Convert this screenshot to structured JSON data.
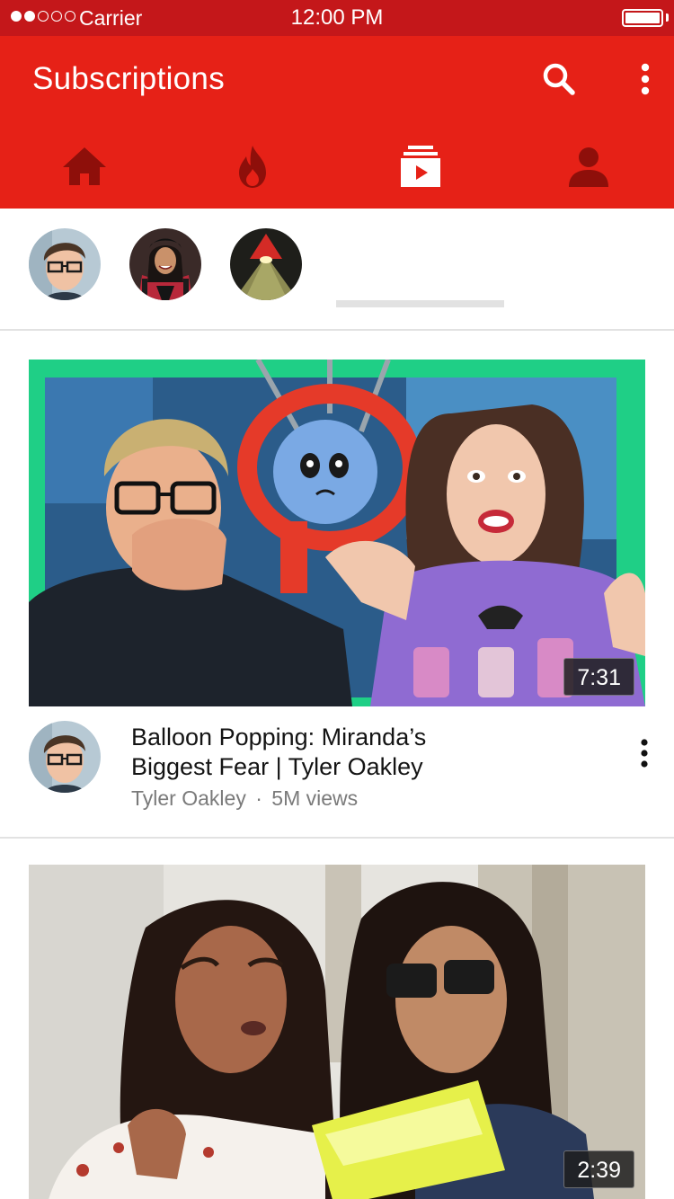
{
  "status_bar": {
    "carrier": "Carrier",
    "time": "12:00 PM",
    "signal_bars_filled": 2,
    "signal_bars_total": 5
  },
  "app_bar": {
    "title": "Subscriptions",
    "background_color": "#e62117",
    "actions": [
      {
        "icon": "search-icon"
      },
      {
        "icon": "more-vert-icon"
      }
    ]
  },
  "tabs": [
    {
      "name": "home",
      "icon": "home-icon",
      "active": false
    },
    {
      "name": "trending",
      "icon": "flame-icon",
      "active": false
    },
    {
      "name": "subscriptions",
      "icon": "subscriptions-icon",
      "active": true
    },
    {
      "name": "account",
      "icon": "person-icon",
      "active": false
    }
  ],
  "subscribed_channels": [
    {
      "avatar": "tyler-oakley-avatar"
    },
    {
      "avatar": "channel-avatar-woman"
    },
    {
      "avatar": "channel-avatar-lamp"
    }
  ],
  "videos": [
    {
      "title_line1": "Balloon Popping: Miranda’s",
      "title_line2": "Biggest Fear | Tyler Oakley",
      "channel": "Tyler Oakley",
      "separator": "·",
      "views": "5M views",
      "duration": "7:31",
      "thumbnail": "balloon-popping-thumbnail"
    },
    {
      "duration": "2:39",
      "thumbnail": "two-women-thumbnail"
    }
  ]
}
